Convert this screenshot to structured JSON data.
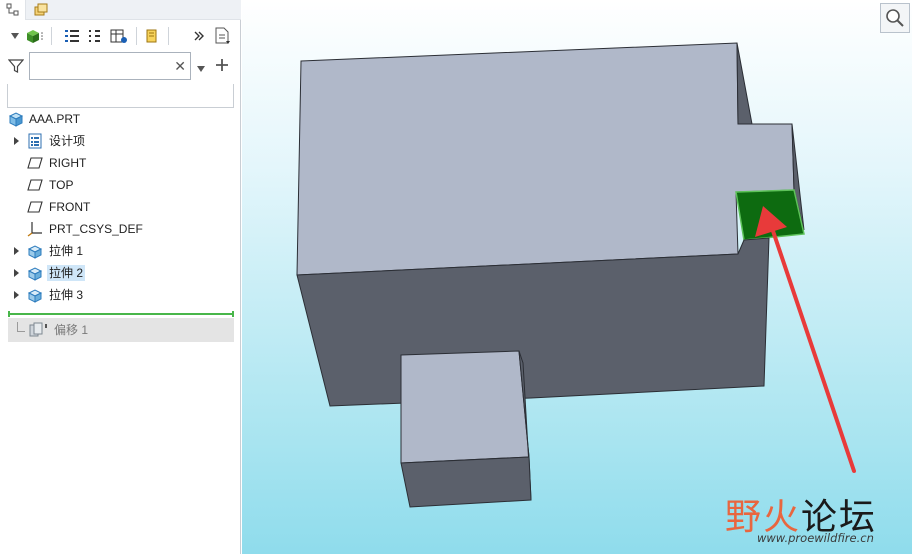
{
  "model_tree": {
    "root_label": "AAA.PRT",
    "items": [
      {
        "label": "设计项",
        "expandable": true,
        "icon": "layer-list-icon"
      },
      {
        "label": "RIGHT",
        "expandable": false,
        "icon": "datum-plane-icon"
      },
      {
        "label": "TOP",
        "expandable": false,
        "icon": "datum-plane-icon"
      },
      {
        "label": "FRONT",
        "expandable": false,
        "icon": "datum-plane-icon"
      },
      {
        "label": "PRT_CSYS_DEF",
        "expandable": false,
        "icon": "csys-icon"
      },
      {
        "label": "拉伸 1",
        "expandable": true,
        "icon": "extrude-icon"
      },
      {
        "label": "拉伸 2",
        "expandable": true,
        "icon": "extrude-icon",
        "selected": true
      },
      {
        "label": "拉伸 3",
        "expandable": true,
        "icon": "extrude-icon"
      }
    ],
    "suppressed_item": {
      "label": "偏移 1",
      "icon": "offset-icon"
    }
  },
  "search": {
    "value": "",
    "placeholder": ""
  },
  "watermark": {
    "part1": "野火",
    "part2": "论坛",
    "url": "www.proewildfire.cn"
  },
  "colors": {
    "model_top_face": "#b0b8c9",
    "model_side_face": "#5b606b",
    "highlighted_face": "#0d6b10",
    "arrow": "#e83a3a",
    "insert_line": "#48b64a",
    "selection": "#cfe6f8"
  }
}
